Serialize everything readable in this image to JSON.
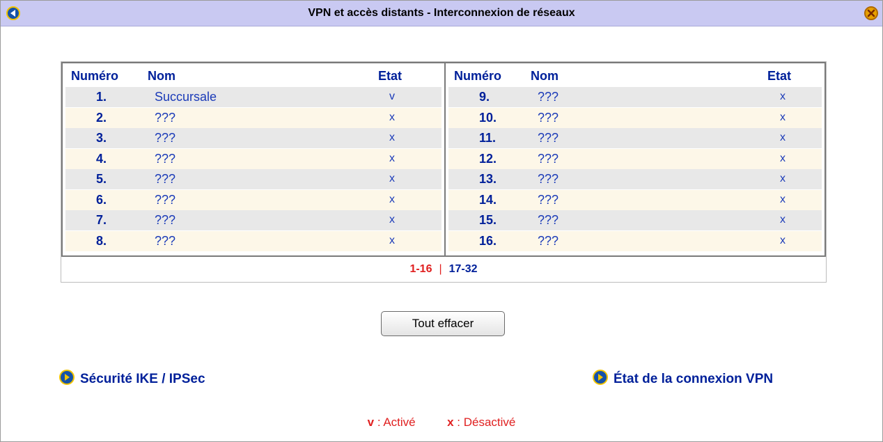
{
  "window": {
    "title": "VPN et accès distants - Interconnexion de réseaux"
  },
  "table": {
    "headers": {
      "number": "Numéro",
      "name": "Nom",
      "state": "Etat"
    },
    "left_rows": [
      {
        "num": "1.",
        "name": "Succursale",
        "state": "v"
      },
      {
        "num": "2.",
        "name": "???",
        "state": "x"
      },
      {
        "num": "3.",
        "name": "???",
        "state": "x"
      },
      {
        "num": "4.",
        "name": "???",
        "state": "x"
      },
      {
        "num": "5.",
        "name": "???",
        "state": "x"
      },
      {
        "num": "6.",
        "name": "???",
        "state": "x"
      },
      {
        "num": "7.",
        "name": "???",
        "state": "x"
      },
      {
        "num": "8.",
        "name": "???",
        "state": "x"
      }
    ],
    "right_rows": [
      {
        "num": "9.",
        "name": "???",
        "state": "x"
      },
      {
        "num": "10.",
        "name": "???",
        "state": "x"
      },
      {
        "num": "11.",
        "name": "???",
        "state": "x"
      },
      {
        "num": "12.",
        "name": "???",
        "state": "x"
      },
      {
        "num": "13.",
        "name": "???",
        "state": "x"
      },
      {
        "num": "14.",
        "name": "???",
        "state": "x"
      },
      {
        "num": "15.",
        "name": "???",
        "state": "x"
      },
      {
        "num": "16.",
        "name": "???",
        "state": "x"
      }
    ]
  },
  "pager": {
    "current": "1-16",
    "separator": "|",
    "next": "17-32"
  },
  "actions": {
    "clear_all": "Tout effacer"
  },
  "links": {
    "ike_security": "Sécurité IKE / IPSec",
    "vpn_status": "État de la connexion VPN"
  },
  "legend": {
    "active_key": "v",
    "active_label": ": Activé",
    "inactive_key": "x",
    "inactive_label": ": Désactivé"
  },
  "colors": {
    "title_bar": "#c9c9f2",
    "accent_blue": "#00209a",
    "accent_red": "#e02020"
  }
}
